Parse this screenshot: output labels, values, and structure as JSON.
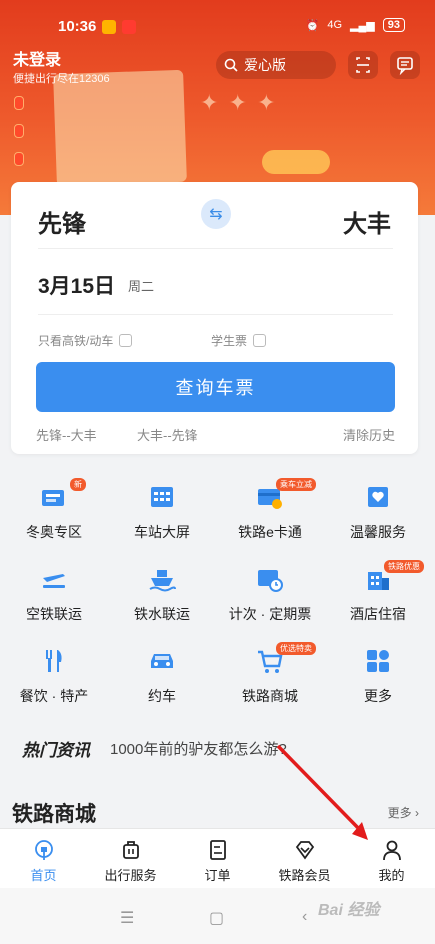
{
  "status_bar": {
    "time": "10:36",
    "battery": "93",
    "network": "4G"
  },
  "header": {
    "login_title": "未登录",
    "login_subtitle": "便捷出行尽在12306",
    "search_label": "爱心版"
  },
  "booking": {
    "from": "先锋",
    "to": "大丰",
    "date": "3月15日",
    "weekday": "周二",
    "option_high_speed": "只看高铁/动车",
    "option_student": "学生票",
    "query_button": "查询车票",
    "history": [
      "先锋--大丰",
      "大丰--先锋"
    ],
    "clear_history": "清除历史"
  },
  "services": [
    {
      "label": "冬奥专区",
      "icon": "winter-olympics-icon",
      "tag": "新"
    },
    {
      "label": "车站大屏",
      "icon": "station-screen-icon",
      "tag": ""
    },
    {
      "label": "铁路e卡通",
      "icon": "railway-ecard-icon",
      "tag": "乘车立减"
    },
    {
      "label": "温馨服务",
      "icon": "warm-service-icon",
      "tag": ""
    },
    {
      "label": "空铁联运",
      "icon": "air-rail-icon",
      "tag": ""
    },
    {
      "label": "铁水联运",
      "icon": "rail-water-icon",
      "tag": ""
    },
    {
      "label": "计次 · 定期票",
      "icon": "periodic-ticket-icon",
      "tag": ""
    },
    {
      "label": "酒店住宿",
      "icon": "hotel-icon",
      "tag": "铁路优惠"
    },
    {
      "label": "餐饮 · 特产",
      "icon": "dining-icon",
      "tag": ""
    },
    {
      "label": "约车",
      "icon": "car-icon",
      "tag": ""
    },
    {
      "label": "铁路商城",
      "icon": "shopping-cart-icon",
      "tag": "优选特卖"
    },
    {
      "label": "更多",
      "icon": "more-apps-icon",
      "tag": ""
    }
  ],
  "hot_news": {
    "title": "热门资讯",
    "text": "1000年前的驴友都怎么游?"
  },
  "mall": {
    "title": "铁路商城",
    "more": "更多"
  },
  "tabs": [
    {
      "label": "首页",
      "icon": "home-icon",
      "active": true
    },
    {
      "label": "出行服务",
      "icon": "luggage-icon",
      "active": false
    },
    {
      "label": "订单",
      "icon": "order-icon",
      "active": false
    },
    {
      "label": "铁路会员",
      "icon": "diamond-icon",
      "active": false
    },
    {
      "label": "我的",
      "icon": "user-icon",
      "active": false
    }
  ],
  "colors": {
    "brand_red": "#e23c1d",
    "accent_blue": "#3a8eef",
    "annotation_red": "#e21c1c"
  }
}
